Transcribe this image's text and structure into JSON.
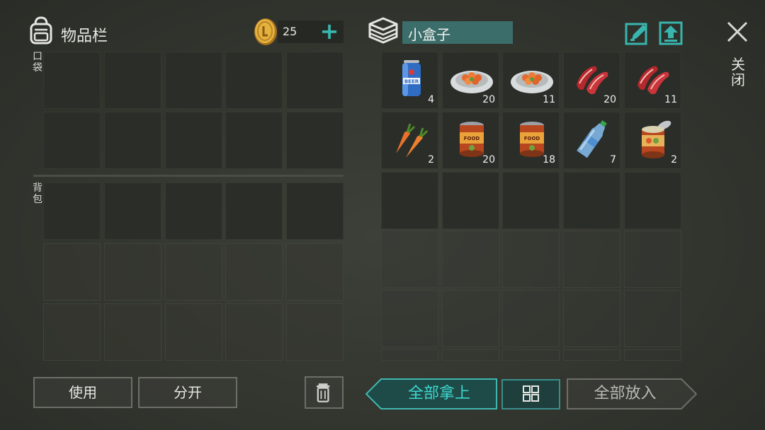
{
  "inventory": {
    "title": "物品栏",
    "pocket_label": "口袋",
    "backpack_label": "背包",
    "coins": "25",
    "add_coins": "+"
  },
  "container": {
    "name": "小盒子",
    "items": [
      {
        "icon": "beer-can-icon",
        "count": "4"
      },
      {
        "icon": "salad-plate-icon",
        "count": "20"
      },
      {
        "icon": "salad-plate-icon",
        "count": "11"
      },
      {
        "icon": "raw-meat-icon",
        "count": "20"
      },
      {
        "icon": "raw-meat-icon",
        "count": "11"
      },
      {
        "icon": "carrot-icon",
        "count": "2"
      },
      {
        "icon": "canned-food-icon",
        "count": "20"
      },
      {
        "icon": "canned-food-icon",
        "count": "18"
      },
      {
        "icon": "water-bottle-icon",
        "count": "7"
      },
      {
        "icon": "open-can-icon",
        "count": "2"
      }
    ]
  },
  "close_label": "关闭",
  "buttons": {
    "use": "使用",
    "split": "分开",
    "take_all": "全部拿上",
    "put_all": "全部放入"
  },
  "colors": {
    "accent": "#38b5ae",
    "background": "#33352f",
    "slot": "#2b2d29"
  }
}
